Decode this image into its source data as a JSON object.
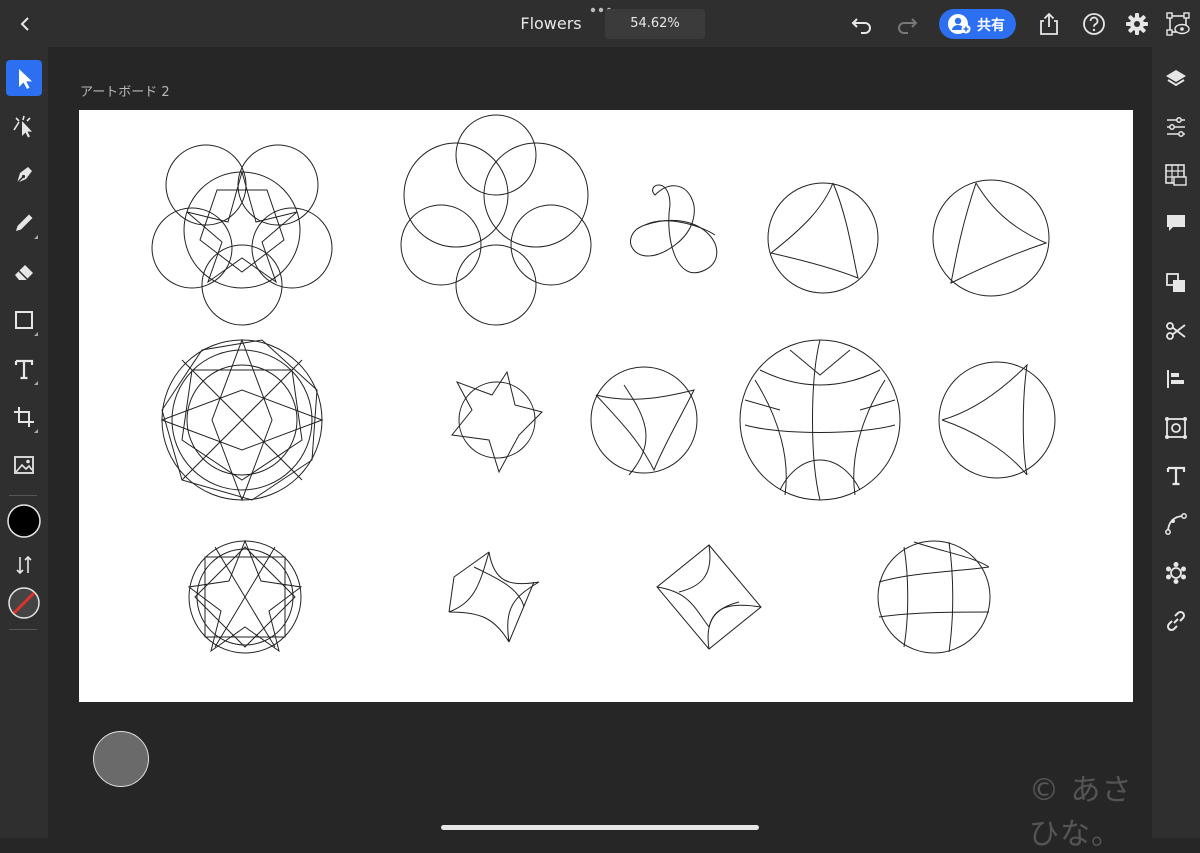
{
  "header": {
    "document_title": "Flowers",
    "zoom_level": "54.62%",
    "share_label": "共有",
    "icons": [
      "back-icon",
      "more-dots-icon",
      "undo-icon",
      "redo-icon",
      "share-user-icon",
      "export-icon",
      "help-icon",
      "settings-icon",
      "preview-icon"
    ]
  },
  "toolbar": {
    "tools": [
      "select-tool",
      "direct-select-tool",
      "pen-tool",
      "pencil-tool",
      "eraser-tool",
      "shape-tool",
      "type-tool",
      "transform-tool",
      "image-tool"
    ],
    "fill_color": "#000000",
    "stroke_color": "none"
  },
  "right_panel": {
    "icons": [
      "layers-icon",
      "properties-icon",
      "swatches-icon",
      "comments-icon",
      "arrange-icon",
      "cut-icon",
      "align-icon",
      "repeat-icon",
      "type-icon",
      "path-icon",
      "effects-icon",
      "link-icon"
    ]
  },
  "artboard": {
    "name": "アートボード 2",
    "copyright": "© あさひな。",
    "background": "#ffffff"
  },
  "colors": {
    "accent": "#2c6ff0",
    "chrome": "#2f2f2f",
    "canvas": "#262626"
  }
}
